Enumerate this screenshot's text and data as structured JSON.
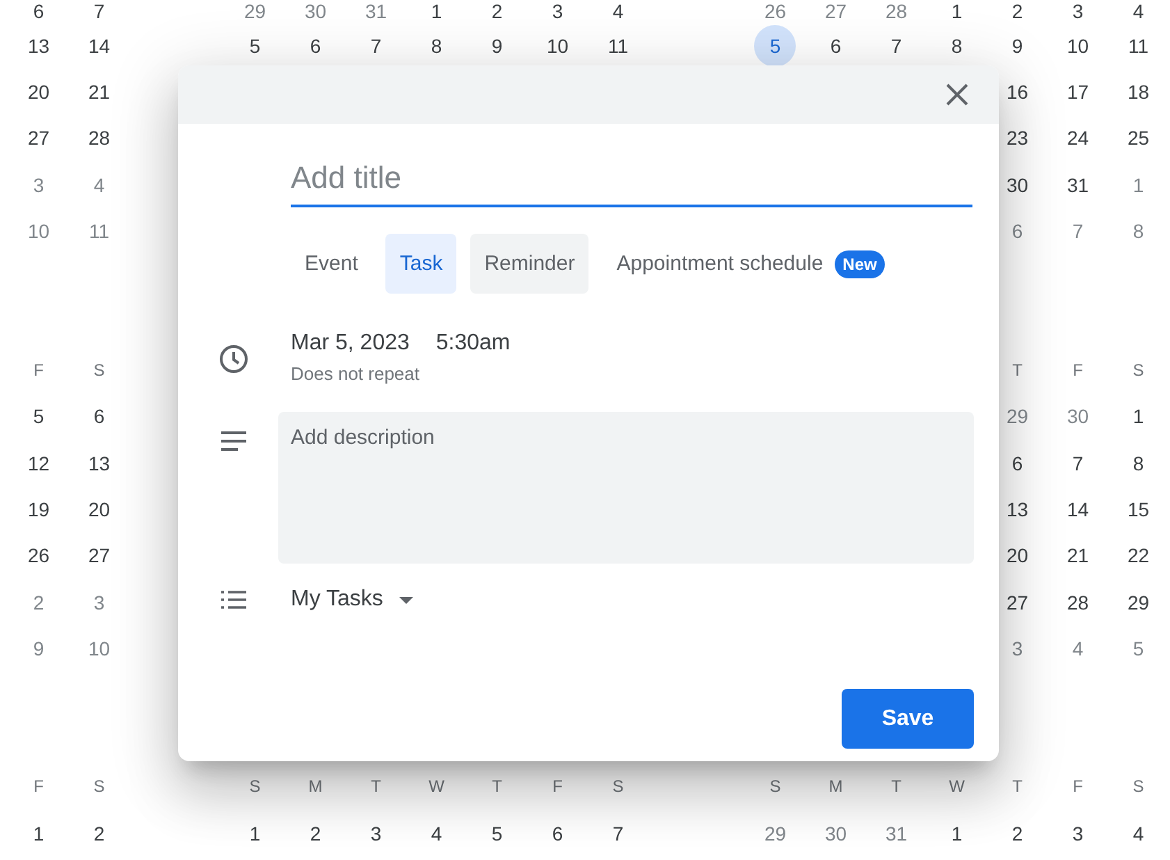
{
  "background": {
    "bands": [
      {
        "blocks": [
          {
            "kind": "left",
            "rows": [
              {
                "kind": "days",
                "cells": [
                  {
                    "day": "6",
                    "muted": false,
                    "today": false
                  },
                  {
                    "day": "7",
                    "muted": false,
                    "today": false
                  }
                ]
              },
              {
                "kind": "days",
                "cells": [
                  {
                    "day": "13",
                    "muted": false,
                    "today": false
                  },
                  {
                    "day": "14",
                    "muted": false,
                    "today": false
                  }
                ]
              },
              {
                "kind": "days",
                "cells": [
                  {
                    "day": "20",
                    "muted": false,
                    "today": false
                  },
                  {
                    "day": "21",
                    "muted": false,
                    "today": false
                  }
                ]
              },
              {
                "kind": "days",
                "cells": [
                  {
                    "day": "27",
                    "muted": false,
                    "today": false
                  },
                  {
                    "day": "28",
                    "muted": false,
                    "today": false
                  }
                ]
              },
              {
                "kind": "days",
                "cells": [
                  {
                    "day": "3",
                    "muted": true,
                    "today": false
                  },
                  {
                    "day": "4",
                    "muted": true,
                    "today": false
                  }
                ]
              },
              {
                "kind": "days",
                "cells": [
                  {
                    "day": "10",
                    "muted": true,
                    "today": false
                  },
                  {
                    "day": "11",
                    "muted": true,
                    "today": false
                  }
                ]
              }
            ]
          },
          {
            "kind": "middle",
            "rows": [
              {
                "kind": "days",
                "cells": [
                  {
                    "day": "29",
                    "muted": true,
                    "today": false
                  },
                  {
                    "day": "30",
                    "muted": true,
                    "today": false
                  },
                  {
                    "day": "31",
                    "muted": true,
                    "today": false
                  },
                  {
                    "day": "1",
                    "muted": false,
                    "today": false
                  },
                  {
                    "day": "2",
                    "muted": false,
                    "today": false
                  },
                  {
                    "day": "3",
                    "muted": false,
                    "today": false
                  },
                  {
                    "day": "4",
                    "muted": false,
                    "today": false
                  }
                ]
              },
              {
                "kind": "days",
                "cells": [
                  {
                    "day": "5",
                    "muted": false,
                    "today": false
                  },
                  {
                    "day": "6",
                    "muted": false,
                    "today": false
                  },
                  {
                    "day": "7",
                    "muted": false,
                    "today": false
                  },
                  {
                    "day": "8",
                    "muted": false,
                    "today": false
                  },
                  {
                    "day": "9",
                    "muted": false,
                    "today": false
                  },
                  {
                    "day": "10",
                    "muted": false,
                    "today": false
                  },
                  {
                    "day": "11",
                    "muted": false,
                    "today": false
                  }
                ]
              }
            ]
          },
          {
            "kind": "right",
            "rows": [
              {
                "kind": "days",
                "cells": [
                  {
                    "day": "26",
                    "muted": true,
                    "today": false
                  },
                  {
                    "day": "27",
                    "muted": true,
                    "today": false
                  },
                  {
                    "day": "28",
                    "muted": true,
                    "today": false
                  },
                  {
                    "day": "1",
                    "muted": false,
                    "today": false
                  },
                  {
                    "day": "2",
                    "muted": false,
                    "today": false
                  },
                  {
                    "day": "3",
                    "muted": false,
                    "today": false
                  },
                  {
                    "day": "4",
                    "muted": false,
                    "today": false
                  }
                ]
              },
              {
                "kind": "days",
                "cells": [
                  {
                    "day": "5",
                    "muted": false,
                    "today": true
                  },
                  {
                    "day": "6",
                    "muted": false,
                    "today": false
                  },
                  {
                    "day": "7",
                    "muted": false,
                    "today": false
                  },
                  {
                    "day": "8",
                    "muted": false,
                    "today": false
                  },
                  {
                    "day": "9",
                    "muted": false,
                    "today": false
                  },
                  {
                    "day": "10",
                    "muted": false,
                    "today": false
                  },
                  {
                    "day": "11",
                    "muted": false,
                    "today": false
                  }
                ]
              },
              {
                "kind": "days",
                "cells": [
                  {
                    "day": "16",
                    "muted": false,
                    "today": false
                  },
                  {
                    "day": "17",
                    "muted": false,
                    "today": false
                  },
                  {
                    "day": "18",
                    "muted": false,
                    "today": false
                  }
                ]
              },
              {
                "kind": "days",
                "cells": [
                  {
                    "day": "23",
                    "muted": false,
                    "today": false
                  },
                  {
                    "day": "24",
                    "muted": false,
                    "today": false
                  },
                  {
                    "day": "25",
                    "muted": false,
                    "today": false
                  }
                ]
              },
              {
                "kind": "days",
                "cells": [
                  {
                    "day": "30",
                    "muted": false,
                    "today": false
                  },
                  {
                    "day": "31",
                    "muted": false,
                    "today": false
                  },
                  {
                    "day": "1",
                    "muted": true,
                    "today": false
                  }
                ]
              },
              {
                "kind": "days",
                "cells": [
                  {
                    "day": "6",
                    "muted": true,
                    "today": false
                  },
                  {
                    "day": "7",
                    "muted": true,
                    "today": false
                  },
                  {
                    "day": "8",
                    "muted": true,
                    "today": false
                  }
                ]
              }
            ]
          }
        ]
      },
      {
        "blocks": [
          {
            "kind": "left",
            "rows": [
              {
                "kind": "weekdays",
                "cells": [
                  "F",
                  "S"
                ]
              },
              {
                "kind": "days",
                "cells": [
                  {
                    "day": "5",
                    "muted": false,
                    "today": false
                  },
                  {
                    "day": "6",
                    "muted": false,
                    "today": false
                  }
                ]
              },
              {
                "kind": "days",
                "cells": [
                  {
                    "day": "12",
                    "muted": false,
                    "today": false
                  },
                  {
                    "day": "13",
                    "muted": false,
                    "today": false
                  }
                ]
              },
              {
                "kind": "days",
                "cells": [
                  {
                    "day": "19",
                    "muted": false,
                    "today": false
                  },
                  {
                    "day": "20",
                    "muted": false,
                    "today": false
                  }
                ]
              },
              {
                "kind": "days",
                "cells": [
                  {
                    "day": "26",
                    "muted": false,
                    "today": false
                  },
                  {
                    "day": "27",
                    "muted": false,
                    "today": false
                  }
                ]
              },
              {
                "kind": "days",
                "cells": [
                  {
                    "day": "2",
                    "muted": true,
                    "today": false
                  },
                  {
                    "day": "3",
                    "muted": true,
                    "today": false
                  }
                ]
              },
              {
                "kind": "days",
                "cells": [
                  {
                    "day": "9",
                    "muted": true,
                    "today": false
                  },
                  {
                    "day": "10",
                    "muted": true,
                    "today": false
                  }
                ]
              }
            ]
          },
          {
            "kind": "right",
            "rows": [
              {
                "kind": "weekdays",
                "cells": [
                  "T",
                  "F",
                  "S"
                ]
              },
              {
                "kind": "days",
                "cells": [
                  {
                    "day": "29",
                    "muted": true,
                    "today": false
                  },
                  {
                    "day": "30",
                    "muted": true,
                    "today": false
                  },
                  {
                    "day": "1",
                    "muted": false,
                    "today": false
                  }
                ]
              },
              {
                "kind": "days",
                "cells": [
                  {
                    "day": "6",
                    "muted": false,
                    "today": false
                  },
                  {
                    "day": "7",
                    "muted": false,
                    "today": false
                  },
                  {
                    "day": "8",
                    "muted": false,
                    "today": false
                  }
                ]
              },
              {
                "kind": "days",
                "cells": [
                  {
                    "day": "13",
                    "muted": false,
                    "today": false
                  },
                  {
                    "day": "14",
                    "muted": false,
                    "today": false
                  },
                  {
                    "day": "15",
                    "muted": false,
                    "today": false
                  }
                ]
              },
              {
                "kind": "days",
                "cells": [
                  {
                    "day": "20",
                    "muted": false,
                    "today": false
                  },
                  {
                    "day": "21",
                    "muted": false,
                    "today": false
                  },
                  {
                    "day": "22",
                    "muted": false,
                    "today": false
                  }
                ]
              },
              {
                "kind": "days",
                "cells": [
                  {
                    "day": "27",
                    "muted": false,
                    "today": false
                  },
                  {
                    "day": "28",
                    "muted": false,
                    "today": false
                  },
                  {
                    "day": "29",
                    "muted": false,
                    "today": false
                  }
                ]
              },
              {
                "kind": "days",
                "cells": [
                  {
                    "day": "3",
                    "muted": true,
                    "today": false
                  },
                  {
                    "day": "4",
                    "muted": true,
                    "today": false
                  },
                  {
                    "day": "5",
                    "muted": true,
                    "today": false
                  }
                ]
              }
            ]
          }
        ]
      },
      {
        "blocks": [
          {
            "kind": "left",
            "rows": [
              {
                "kind": "weekdays",
                "cells": [
                  "F",
                  "S"
                ]
              },
              {
                "kind": "days",
                "cells": [
                  {
                    "day": "1",
                    "muted": false,
                    "today": false
                  },
                  {
                    "day": "2",
                    "muted": false,
                    "today": false
                  }
                ]
              }
            ]
          },
          {
            "kind": "middle",
            "rows": [
              {
                "kind": "weekdays",
                "cells": [
                  "S",
                  "M",
                  "T",
                  "W",
                  "T",
                  "F",
                  "S"
                ]
              },
              {
                "kind": "days",
                "cells": [
                  {
                    "day": "1",
                    "muted": false,
                    "today": false
                  },
                  {
                    "day": "2",
                    "muted": false,
                    "today": false
                  },
                  {
                    "day": "3",
                    "muted": false,
                    "today": false
                  },
                  {
                    "day": "4",
                    "muted": false,
                    "today": false
                  },
                  {
                    "day": "5",
                    "muted": false,
                    "today": false
                  },
                  {
                    "day": "6",
                    "muted": false,
                    "today": false
                  },
                  {
                    "day": "7",
                    "muted": false,
                    "today": false
                  }
                ]
              }
            ]
          },
          {
            "kind": "right",
            "rows": [
              {
                "kind": "weekdays",
                "cells": [
                  "S",
                  "M",
                  "T",
                  "W",
                  "T",
                  "F",
                  "S"
                ]
              },
              {
                "kind": "days",
                "cells": [
                  {
                    "day": "29",
                    "muted": true,
                    "today": false
                  },
                  {
                    "day": "30",
                    "muted": true,
                    "today": false
                  },
                  {
                    "day": "31",
                    "muted": true,
                    "today": false
                  },
                  {
                    "day": "1",
                    "muted": false,
                    "today": false
                  },
                  {
                    "day": "2",
                    "muted": false,
                    "today": false
                  },
                  {
                    "day": "3",
                    "muted": false,
                    "today": false
                  },
                  {
                    "day": "4",
                    "muted": false,
                    "today": false
                  }
                ]
              }
            ]
          }
        ]
      }
    ]
  },
  "dialog": {
    "title": {
      "placeholder": "Add title"
    },
    "tabs": [
      {
        "label": "Event",
        "selected": false,
        "hovered": false
      },
      {
        "label": "Task",
        "selected": true,
        "hovered": false
      },
      {
        "label": "Reminder",
        "selected": false,
        "hovered": true
      },
      {
        "label": "Appointment schedule",
        "selected": false,
        "hovered": false,
        "badge": "New"
      }
    ],
    "date": "Mar 5, 2023",
    "time": "5:30am",
    "repeat": "Does not repeat",
    "description": {
      "placeholder": "Add description"
    },
    "task_list": "My Tasks",
    "save_button": "Save"
  }
}
